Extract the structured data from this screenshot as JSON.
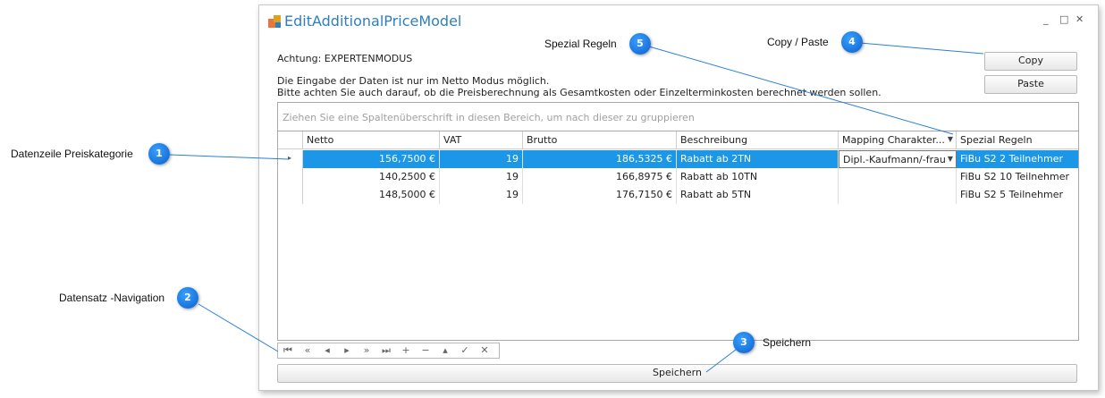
{
  "window": {
    "title": "EditAdditionalPriceModel",
    "controls": [
      "_",
      "□",
      "✕"
    ],
    "mode_notice": "Achtung: EXPERTENMODUS",
    "info_line1": "Die Eingabe der Daten ist nur im Netto Modus möglich.",
    "info_line2": "Bitte achten Sie auch darauf, ob die Preisberechnung als Gesamtkosten oder Einzelterminkosten berechnet werden sollen.",
    "copy_label": "Copy",
    "paste_label": "Paste",
    "save_label": "Speichern"
  },
  "grid": {
    "group_hint": "Ziehen Sie eine Spaltenüberschrift in diesen Bereich, um nach dieser zu gruppieren",
    "columns": [
      "Netto",
      "VAT",
      "Brutto",
      "Beschreibung",
      "Mapping Charakter...",
      "Spezial Regeln"
    ],
    "rows": [
      {
        "netto": "156,7500 €",
        "vat": "19",
        "brutto": "186,5325 €",
        "beschreibung": "Rabatt ab 2TN",
        "mapping": "Dipl.-Kaufmann/-frau",
        "regeln": "FiBu S2 2 Teilnehmer",
        "selected": true
      },
      {
        "netto": "140,2500 €",
        "vat": "19",
        "brutto": "166,8975 €",
        "beschreibung": "Rabatt ab 10TN",
        "mapping": "",
        "regeln": "FiBu S2 10 Teilnehmer",
        "selected": false
      },
      {
        "netto": "148,5000 €",
        "vat": "19",
        "brutto": "176,7150 €",
        "beschreibung": "Rabatt ab 5TN",
        "mapping": "",
        "regeln": "FiBu S2 5 Teilnehmer",
        "selected": false
      }
    ]
  },
  "navigator": {
    "icons": [
      "first-icon",
      "prev-page-icon",
      "prev-icon",
      "next-icon",
      "next-page-icon",
      "last-icon",
      "add-icon",
      "remove-icon",
      "edit-icon",
      "apply-icon",
      "cancel-icon"
    ],
    "glyphs": [
      "⏮",
      "«",
      "◂",
      "▸",
      "»",
      "⏭",
      "+",
      "−",
      "▴",
      "✓",
      "✕"
    ]
  },
  "callouts": [
    {
      "number": "1",
      "label": "Datenzeile Preiskategorie"
    },
    {
      "number": "2",
      "label": "Datensatz -Navigation"
    },
    {
      "number": "3",
      "label": "Speichern"
    },
    {
      "number": "4",
      "label": "Copy / Paste"
    },
    {
      "number": "5",
      "label": "Spezial Regeln"
    }
  ],
  "colors": {
    "accent": "#1c97e8",
    "title": "#2e7fc0",
    "callout": "#0a6fe0"
  }
}
